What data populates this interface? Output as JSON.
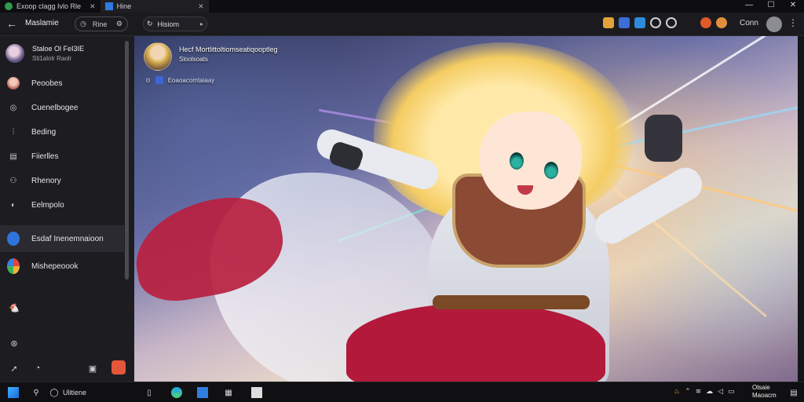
{
  "titlebar": {
    "tabs": [
      {
        "label": "Exoop clagg Ivlo Rle",
        "active": false,
        "icon": "globe-icon"
      },
      {
        "label": "Hine",
        "active": true,
        "icon": "app-icon"
      }
    ],
    "controls": {
      "minimize": "—",
      "maximize": "☐",
      "close": "✕"
    }
  },
  "toolbar": {
    "app_name": "Maslamie",
    "history_pill_label": "Rine",
    "channel_pill_label": "Hisiom",
    "connect_label": "Conn",
    "icons": [
      "folder-icon",
      "bookmark-icon",
      "grid-icon",
      "history-icon",
      "notification-icon",
      "share-icon"
    ],
    "icon_colors": [
      "#e1a23a",
      "#3a6fd8",
      "#2e8bdc",
      "#cfcfd6",
      "#cfcfd6",
      "#e05a2a"
    ]
  },
  "sidebar": {
    "user": {
      "name": "Staloe Ol FeI3IE",
      "subtitle": "Sti1alolr Raolr"
    },
    "items": [
      {
        "label": "Peoobes",
        "icon": "avatar-icon",
        "active": false
      },
      {
        "label": "Cuenelbogee",
        "icon": "compass-icon",
        "active": false
      },
      {
        "label": "Beding",
        "icon": "chart-icon",
        "active": false
      },
      {
        "label": "Fiierlles",
        "icon": "clipboard-icon",
        "active": false
      },
      {
        "label": "Rhenory",
        "icon": "people-icon",
        "active": false
      },
      {
        "label": "Eelmpolo",
        "icon": "palette-icon",
        "active": false
      },
      {
        "label": "Esdaf Inenemnaioon",
        "icon": "app-badge-icon",
        "active": true
      },
      {
        "label": "Mishepeoook",
        "icon": "pinwheel-icon",
        "active": false
      }
    ],
    "bottom_icons": [
      "chicken-icon",
      "discord-icon",
      "rocket-icon",
      "settings-icon",
      "image-icon",
      "store-icon"
    ]
  },
  "content": {
    "author_title": "Hecf Mortlittoltiomseatiqooptleg",
    "author_subtitle": "Sloolsoats",
    "tagline": "Eoaoacomtaiaay"
  },
  "taskbar": {
    "search_label": "Ulitiene",
    "apps": [
      "start-icon",
      "search-icon",
      "widget-icon",
      "edge-icon",
      "store-icon",
      "files-icon",
      "terminal-icon"
    ],
    "tray": [
      "tray-fire-icon",
      "tray-up-icon",
      "tray-wifi-icon",
      "tray-cloud-icon",
      "tray-speaker-icon",
      "tray-battery-icon"
    ],
    "clock_line1": "Olsaie",
    "clock_line2": "Maoacm"
  }
}
